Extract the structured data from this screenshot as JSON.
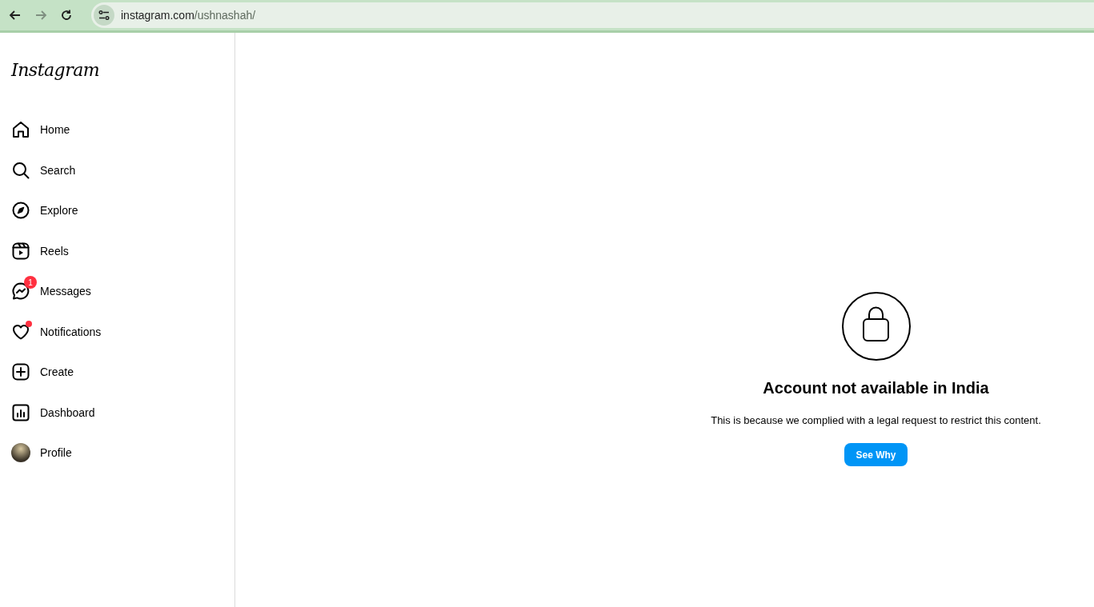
{
  "browser": {
    "url": {
      "host": "instagram.com",
      "path": "/ushnashah/"
    }
  },
  "sidebar": {
    "logo": "Instagram",
    "items": [
      {
        "kind": "home",
        "label": "Home"
      },
      {
        "kind": "search",
        "label": "Search"
      },
      {
        "kind": "explore",
        "label": "Explore"
      },
      {
        "kind": "reels",
        "label": "Reels"
      },
      {
        "kind": "messages",
        "label": "Messages",
        "badge": "1"
      },
      {
        "kind": "notifications",
        "label": "Notifications",
        "dot": true
      },
      {
        "kind": "create",
        "label": "Create"
      },
      {
        "kind": "dashboard",
        "label": "Dashboard"
      },
      {
        "kind": "profile",
        "label": "Profile"
      }
    ]
  },
  "notice": {
    "title": "Account not available in India",
    "message": "This is because we complied with a legal request to restrict this content.",
    "button": "See Why"
  }
}
